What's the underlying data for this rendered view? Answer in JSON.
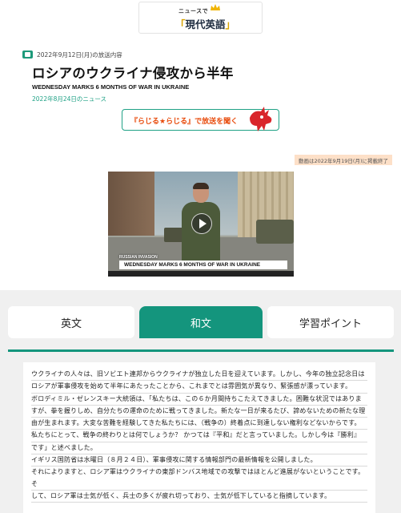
{
  "logo": {
    "line1": "ニュースで",
    "line2_open": "「",
    "line2_text": "現代英語",
    "line2_close": "」"
  },
  "broadcast_date": "2022年9月12日(月)の放送内容",
  "title": "ロシアのウクライナ侵攻から半年",
  "subtitle": "WEDNESDAY MARKS 6 MONTHS OF WAR IN UKRAINE",
  "news_date": "2022年8月24日のニュース",
  "radio_button_label": "『らじる★らじる』で放送を聞く",
  "video_deadline": "動画は2022年9月19日(月)に掲載終了",
  "video": {
    "caption_small": "RUSSIAN INVASION",
    "caption_main": "WEDNESDAY MARKS 6 MONTHS OF WAR IN UKRAINE"
  },
  "tabs": {
    "english": "英文",
    "japanese": "和文",
    "points": "学習ポイント"
  },
  "colors": {
    "accent": "#14957d",
    "radio_text": "#e84b0c",
    "deadline_bg": "#fde0c8"
  },
  "content_lines": [
    "ウクライナの人々は、旧ソビエト連邦からウクライナが独立した日を迎えています。しかし、今年の独立記念日は",
    "ロシアが軍事侵攻を始めて半年にあたったことから、これまでとは雰囲気が異なり、緊張感が漂っています。",
    "ボロディミル・ゼレンスキー大統領は、「私たちは、この６か月間持ちこたえてきました。困難な状況ではありま",
    "すが、拳を握りしめ、自分たちの運命のために戦ってきました。新たな一日が来るたび、諦めないための新たな理",
    "由が生まれます。大変な苦難を経験してきた私たちには、（戦争の）終着点に到達しない権利などないからです。",
    "私たちにとって、戦争の終わりとは何でしょうか？ かつては『平和』だと言っていました。しかし今は『勝利』",
    "です」と述べました。",
    "イギリス国防省は水曜日（８月２４日）、軍事侵攻に関する情報部門の最新情報を公開しました。",
    "それによりますと、ロシア軍はウクライナの東部ドンバス地域での攻撃ではほとんど進展がないということです。そ",
    "して、ロシア軍は士気が低く、兵士の多くが疲れ切っており、士気が低下していると指摘しています。"
  ]
}
